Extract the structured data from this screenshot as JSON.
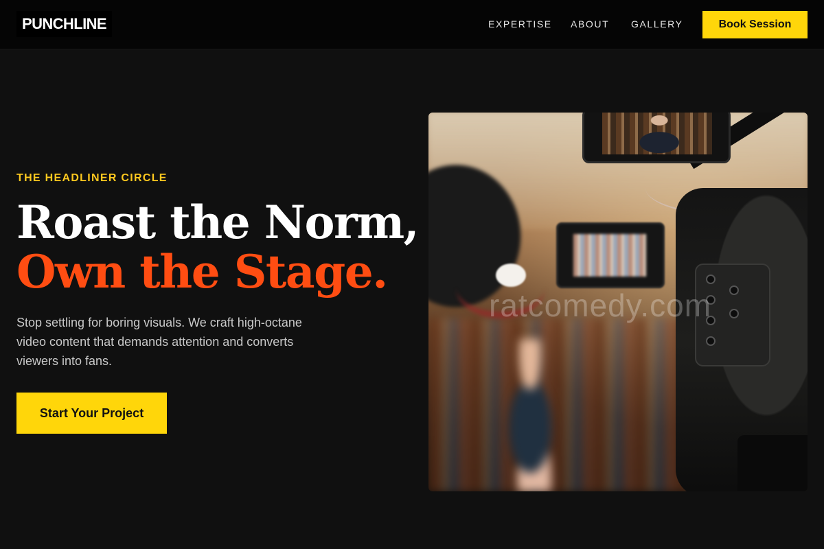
{
  "header": {
    "logo": "PUNCHLINE",
    "nav": [
      {
        "label": "EXPERTISE"
      },
      {
        "label": "ABOUT"
      },
      {
        "label": "GALLERY"
      }
    ],
    "cta_label": "Book Session"
  },
  "hero": {
    "eyebrow": "THE HEADLINER CIRCLE",
    "headline_line1": "Roast the Norm,",
    "headline_line2": "Own the Stage.",
    "lead": "Stop settling for boring visuals. We craft high-octane video content that demands attention and converts viewers into fans.",
    "cta_label": "Start Your Project",
    "image_watermark": "ratcomedy.com"
  },
  "colors": {
    "background": "#101010",
    "header_background": "#050505",
    "accent_yellow": "#ffd60a",
    "eyebrow_gold": "#ffc91f",
    "headline_orange": "#ff4d12",
    "body_text": "#c9c9c9"
  },
  "icons": []
}
